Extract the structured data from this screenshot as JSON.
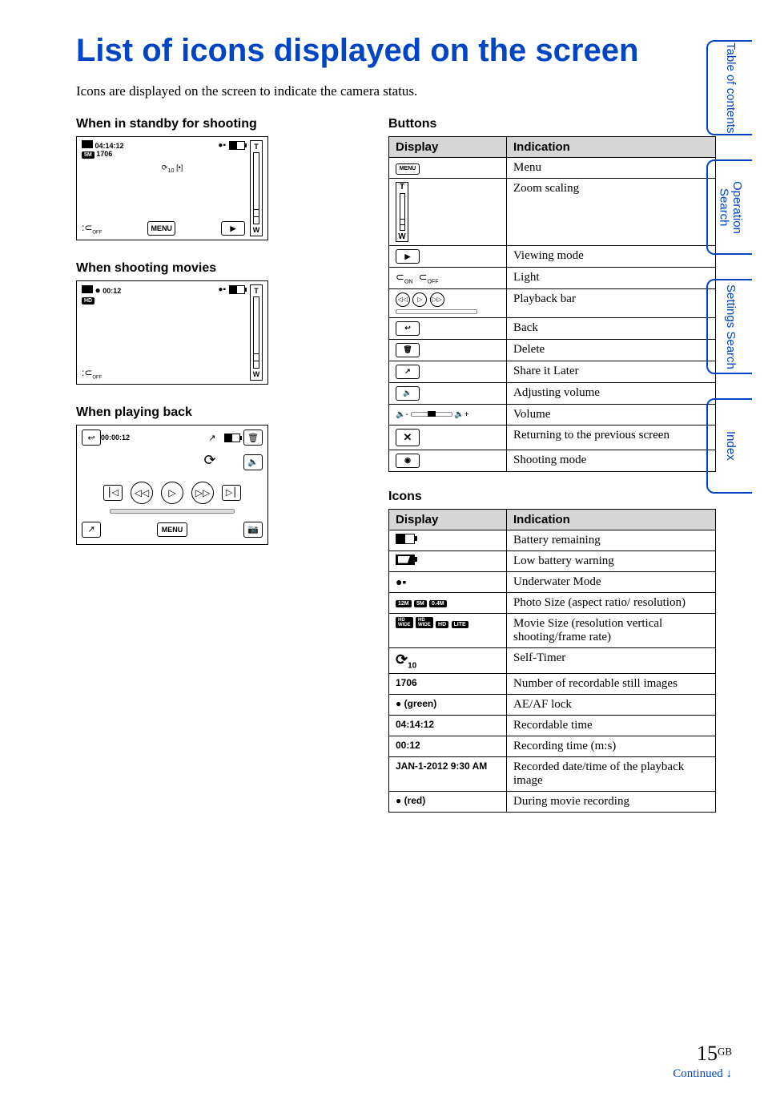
{
  "title": "List of icons displayed on the screen",
  "intro": "Icons are displayed on the screen to indicate the camera status.",
  "sections": {
    "standby": "When in standby for shooting",
    "movies": "When shooting movies",
    "playback": "When playing back",
    "buttons": "Buttons",
    "icons": "Icons"
  },
  "standby_shot": {
    "time": "04:14:12",
    "count": "1706",
    "size_chip": "5M",
    "menu": "MENU"
  },
  "movie_shot": {
    "time": "00:12",
    "chip": "HD"
  },
  "playback_shot": {
    "time": "00:00:12",
    "menu": "MENU"
  },
  "zoom": {
    "t": "T",
    "w": "W"
  },
  "buttons_table": {
    "headers": [
      "Display",
      "Indication"
    ],
    "rows": [
      {
        "display": "MENU",
        "indication": "Menu",
        "icon_type": "menu"
      },
      {
        "display": "T W",
        "indication": "Zoom scaling",
        "icon_type": "zoom"
      },
      {
        "display": "▶",
        "indication": "Viewing mode",
        "icon_type": "box"
      },
      {
        "display": "light",
        "indication": "Light",
        "icon_type": "light"
      },
      {
        "display": "⏮ ▶ ⏭",
        "indication": "Playback bar",
        "icon_type": "playback"
      },
      {
        "display": "↩",
        "indication": "Back",
        "icon_type": "box"
      },
      {
        "display": "🗑",
        "indication": "Delete",
        "icon_type": "box"
      },
      {
        "display": "↗",
        "indication": "Share it Later",
        "icon_type": "box"
      },
      {
        "display": "🔈",
        "indication": "Adjusting volume",
        "icon_type": "box"
      },
      {
        "display": "🔈− ━━ 🔈+",
        "indication": "Volume",
        "icon_type": "volbar"
      },
      {
        "display": "✕",
        "indication": "Returning to the previous screen",
        "icon_type": "box-large"
      },
      {
        "display": "📷",
        "indication": "Shooting mode",
        "icon_type": "box"
      }
    ]
  },
  "icons_table": {
    "headers": [
      "Display",
      "Indication"
    ],
    "rows": [
      {
        "display": "battery",
        "indication": "Battery remaining"
      },
      {
        "display": "lowbatt",
        "indication": "Low battery warning"
      },
      {
        "display": "camcorder",
        "indication": "Underwater Mode"
      },
      {
        "display": "12M 5M 0.4M",
        "indication": "Photo Size (aspect ratio/ resolution)"
      },
      {
        "display": "HD WIDE HD LITE",
        "indication": "Movie Size (resolution vertical shooting/frame rate)"
      },
      {
        "display": "timer10",
        "indication": "Self-Timer"
      },
      {
        "display": "1706",
        "indication": "Number of recordable still images"
      },
      {
        "display": "● (green)",
        "indication": "AE/AF lock"
      },
      {
        "display": "04:14:12",
        "indication": "Recordable time"
      },
      {
        "display": "00:12",
        "indication": "Recording time (m:s)"
      },
      {
        "display": "JAN-1-2012 9:30 AM",
        "indication": "Recorded date/time of the playback image"
      },
      {
        "display": "● (red)",
        "indication": "During movie recording"
      }
    ]
  },
  "sidebar": {
    "toc": "Table of contents",
    "op": "Operation Search",
    "set": "Settings Search",
    "idx": "Index"
  },
  "footer": {
    "page": "15",
    "gb": "GB",
    "continued": "Continued ↓"
  }
}
